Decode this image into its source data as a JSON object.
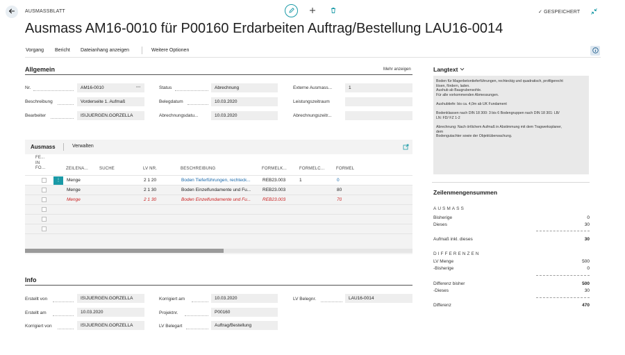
{
  "topbar": {
    "page_type": "AUSMASSBLATT",
    "saved_label": "GESPEICHERT",
    "saved_check": "✓"
  },
  "page_title": "Ausmass AM16-0010 für P00160 Erdarbeiten Auftrag/Bestellung LAU16-0014",
  "actions": {
    "vorgang": "Vorgang",
    "bericht": "Bericht",
    "dateianhang": "Dateianhang anzeigen",
    "weitere": "Weitere Optionen"
  },
  "allgemein": {
    "title": "Allgemein",
    "mehr": "Mehr anzeigen",
    "fields": {
      "nr": {
        "label": "Nr.",
        "value": "AM16-0010",
        "more": "···"
      },
      "beschreibung": {
        "label": "Beschreibung",
        "value": "Vorderseite 1. Aufmaß"
      },
      "bearbeiter": {
        "label": "Bearbeiter",
        "value": "IS\\JUERGEN.GORZELLA"
      },
      "status": {
        "label": "Status",
        "value": "Abrechnung"
      },
      "belegdatum": {
        "label": "Belegdatum",
        "value": "10.03.2020"
      },
      "abrechnungsdatum": {
        "label": "Abrechnungsdatu...",
        "value": "10.03.2020"
      },
      "externe": {
        "label": "Externe Ausmass...",
        "value": "1"
      },
      "leistungszeitraum": {
        "label": "Leistungszeitraum",
        "value": ""
      },
      "abrechnungszeitr": {
        "label": "Abrechnungszeitr...",
        "value": ""
      }
    }
  },
  "ausmass_part": {
    "tab_ausmass": "Ausmass",
    "tab_verwalten": "Verwalten",
    "columns": {
      "fe": "FE...\nIN\nFO...",
      "zeilenart": "ZEILENA...",
      "suche": "SUCHE",
      "lvnr": "LV NR.",
      "beschreibung": "BESCHREIBUNG",
      "formelk": "FORMELK...",
      "formelc": "FORMELC...",
      "formel": "FORMEL"
    },
    "rows": [
      {
        "zeilenart": "Menge",
        "lvnr": "2 1 20",
        "beschreibung": "Boden Tieferführungen, rechteck...",
        "formelk": "REB23.003",
        "formelc": "1",
        "formel": "0",
        "style": "selected"
      },
      {
        "zeilenart": "Menge",
        "lvnr": "2 1 30",
        "beschreibung": "Boden Einzelfundamente und Fu...",
        "formelk": "REB23.003",
        "formelc": "",
        "formel": "80",
        "style": "normal"
      },
      {
        "zeilenart": "Menge",
        "lvnr": "2 1 30",
        "beschreibung": "Boden Einzelfundamente und Fu...",
        "formelk": "REB23.003",
        "formelc": "",
        "formel": "70",
        "style": "red"
      }
    ],
    "colors": {
      "red": "#c81e1e",
      "link": "#1565a8",
      "accent": "#1a9aa7"
    }
  },
  "info": {
    "title": "Info",
    "fields": {
      "erstellt_von": {
        "label": "Erstellt von",
        "value": "IS\\JUERGEN.GORZELLA"
      },
      "erstellt_am": {
        "label": "Erstellt am",
        "value": "10.03.2020"
      },
      "korrigiert_von": {
        "label": "Korrigiert von",
        "value": "IS\\JUERGEN.GORZELLA"
      },
      "korrigiert_am": {
        "label": "Korrigiert am",
        "value": "10.03.2020"
      },
      "projektnr": {
        "label": "Projektnr.",
        "value": "P00160"
      },
      "lv_belegart": {
        "label": "LV Belegart",
        "value": "Auftrag/Bestellung"
      },
      "lv_belegnr": {
        "label": "LV Belegnr.",
        "value": "LAU16-0014"
      }
    }
  },
  "langtext": {
    "title": "Langtext",
    "lines": [
      "Boden für Magerbetontieferführungen, rechteckig und quadratisch, profilgerecht",
      "lösen, fördern, laden.",
      "Aushub ab Baugrubensohle.",
      "Für alle vorkommenden Abmessungen.",
      "",
      "Aushubtiefe: bis ca. 4,0m ab UK Fundament",
      "",
      "Bodenklassen nach DIN 18 300: 3 bis 6 Bodengruppen nach DIN 18 301: LB/",
      "LN: FD/ FZ 1-2",
      "",
      "Abrechnung: Nach örtlichem Aufmaß in Abstimmung mit dem Tragwerksplaner,",
      "dem",
      "Bodengutachter sowie der Objektüberwachung."
    ]
  },
  "summen": {
    "title": "Zeilenmengensummen",
    "ausmass_head": "AUSMASS",
    "bisherige": {
      "label": "Bisherige",
      "value": "0"
    },
    "dieses": {
      "label": "Dieses",
      "value": "30"
    },
    "aufmass_inkl": {
      "label": "Aufmaß inkl. dieses",
      "value": "30"
    },
    "differenzen_head": "DIFFERENZEN",
    "lv_menge": {
      "label": "LV Menge",
      "value": "500"
    },
    "minus_bisherige": {
      "label": "-Bisherige",
      "value": "0"
    },
    "differenz_bisher": {
      "label": "Differenz bisher",
      "value": "500"
    },
    "minus_dieses": {
      "label": "-Dieses",
      "value": "30"
    },
    "differenz": {
      "label": "Differenz",
      "value": "470"
    }
  }
}
